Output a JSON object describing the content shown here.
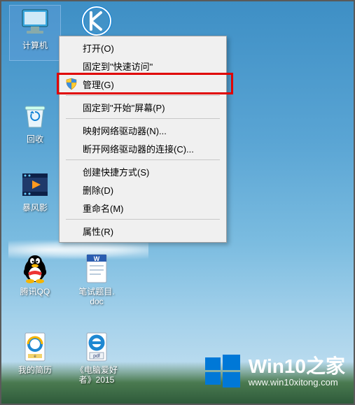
{
  "desktop": {
    "icons": {
      "computer": {
        "label": "计算机"
      },
      "kugou": {
        "label": ""
      },
      "recyclebin": {
        "label": "回收"
      },
      "baofeng": {
        "label": "暴风影"
      },
      "qq": {
        "label": "腾讯QQ"
      },
      "worddoc": {
        "label": "笔试题目.\ndoc"
      },
      "resume": {
        "label": "我的简历"
      },
      "pdfdoc": {
        "label": "《电脑爱好\n者》2015"
      }
    }
  },
  "context_menu": {
    "items": [
      {
        "label": "打开(O)"
      },
      {
        "label": "固定到\"快速访问\""
      },
      {
        "label": "管理(G)",
        "icon": "shield"
      },
      {
        "label": "固定到\"开始\"屏幕(P)"
      },
      {
        "label": "映射网络驱动器(N)..."
      },
      {
        "label": "断开网络驱动器的连接(C)..."
      },
      {
        "label": "创建快捷方式(S)"
      },
      {
        "label": "删除(D)"
      },
      {
        "label": "重命名(M)"
      },
      {
        "label": "属性(R)"
      }
    ]
  },
  "watermark": {
    "title": "Win10之家",
    "url": "www.win10xitong.com"
  }
}
